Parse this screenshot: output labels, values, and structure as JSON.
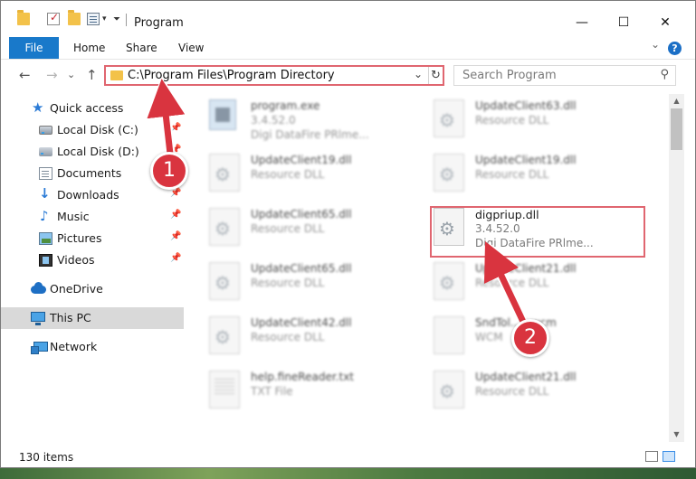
{
  "window": {
    "title": "Program",
    "controls": {
      "minimize": "—",
      "maximize": "☐",
      "close": "✕"
    }
  },
  "ribbon": {
    "tabs": [
      "File",
      "Home",
      "Share",
      "View"
    ],
    "expand": "⌄",
    "help": "?"
  },
  "nav": {
    "back": "←",
    "forward": "→",
    "recent": "⌄",
    "up": "↑",
    "address": "C:\\Program Files\\Program Directory",
    "address_dropdown": "⌄",
    "refresh": "↻",
    "search_placeholder": "Search Program",
    "search_glyph": "⚲"
  },
  "sidebar": {
    "items": [
      {
        "label": "Quick access",
        "icon": "star-icon",
        "pinned": false
      },
      {
        "label": "Local Disk (C:)",
        "icon": "disk-icon",
        "pinned": true
      },
      {
        "label": "Local Disk (D:)",
        "icon": "disk-icon",
        "pinned": true
      },
      {
        "label": "Documents",
        "icon": "documents-icon",
        "pinned": true
      },
      {
        "label": "Downloads",
        "icon": "download-icon",
        "pinned": true
      },
      {
        "label": "Music",
        "icon": "music-icon",
        "pinned": true
      },
      {
        "label": "Pictures",
        "icon": "pictures-icon",
        "pinned": true
      },
      {
        "label": "Videos",
        "icon": "videos-icon",
        "pinned": true
      },
      {
        "label": "OneDrive",
        "icon": "cloud-icon",
        "pinned": false
      },
      {
        "label": "This PC",
        "icon": "pc-icon",
        "pinned": false,
        "selected": true
      },
      {
        "label": "Network",
        "icon": "network-icon",
        "pinned": false
      }
    ],
    "pin_glyph": "📌"
  },
  "files": [
    {
      "name": "program.exe",
      "line2": "3.4.52.0",
      "line3": "Digi DataFire PRlme...",
      "icon": "exe-icon"
    },
    {
      "name": "UpdateClient63.dll",
      "line2": "Resource DLL",
      "line3": "",
      "icon": "dll-icon"
    },
    {
      "name": "UpdateClient19.dll",
      "line2": "Resource DLL",
      "line3": "",
      "icon": "dll-icon"
    },
    {
      "name": "UpdateClient19.dll",
      "line2": "Resource DLL",
      "line3": "",
      "icon": "dll-icon"
    },
    {
      "name": "UpdateClient65.dll",
      "line2": "Resource DLL",
      "line3": "",
      "icon": "dll-icon"
    },
    {
      "name": "digpriup.dll",
      "line2": "3.4.52.0",
      "line3": "Digi DataFire PRlme...",
      "icon": "dll-icon",
      "highlighted": true
    },
    {
      "name": "UpdateClient65.dll",
      "line2": "Resource DLL",
      "line3": "",
      "icon": "dll-icon"
    },
    {
      "name": "UpdateClient21.dll",
      "line2": "Resource DLL",
      "line3": "",
      "icon": "dll-icon"
    },
    {
      "name": "UpdateClient42.dll",
      "line2": "Resource DLL",
      "line3": "",
      "icon": "dll-icon"
    },
    {
      "name": "SndTol...4.wcm",
      "line2": "WCM",
      "line3": "",
      "icon": "file-icon"
    },
    {
      "name": "help.fineReader.txt",
      "line2": "TXT File",
      "line3": "",
      "icon": "txt-icon"
    },
    {
      "name": "UpdateClient21.dll",
      "line2": "Resource DLL",
      "line3": "",
      "icon": "dll-icon"
    }
  ],
  "status": {
    "item_count": "130 items"
  },
  "annotations": {
    "step1": "1",
    "step2": "2",
    "color": "#d9343f"
  },
  "colors": {
    "accent": "#1979ca",
    "highlight_box": "#e06670",
    "selected_bg": "#d9d9d9"
  }
}
